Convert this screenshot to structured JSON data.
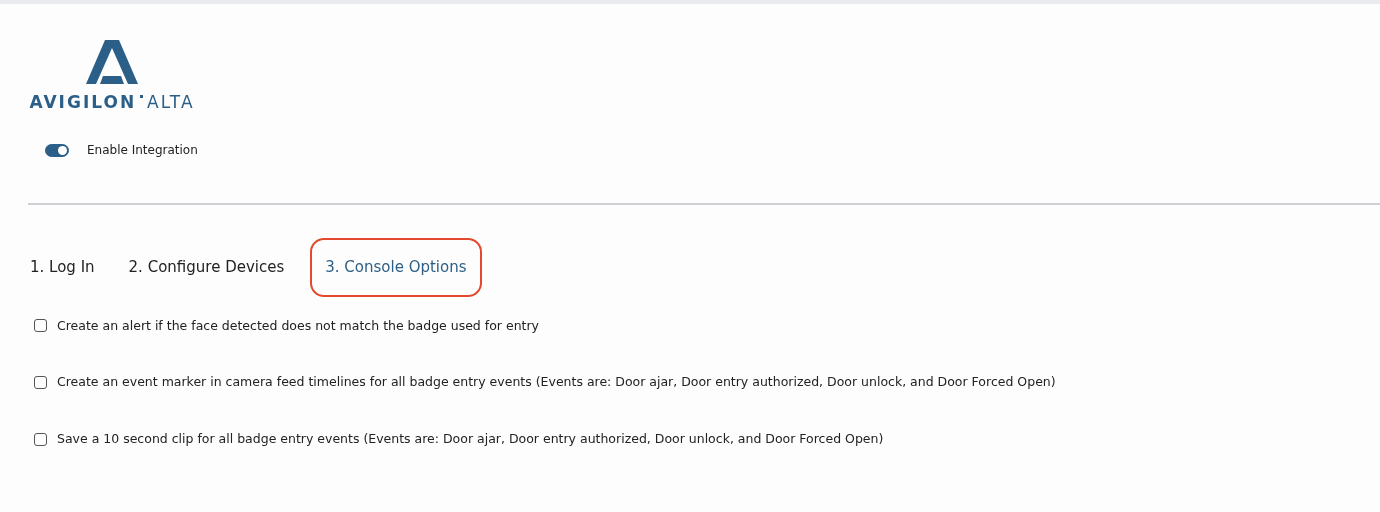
{
  "logo": {
    "brand": "AVIGILON",
    "product": "ALTA"
  },
  "integration": {
    "label": "Enable Integration",
    "on": true
  },
  "tabs": [
    {
      "label": "1. Log In",
      "selected": false
    },
    {
      "label": "2. Configure Devices",
      "selected": false
    },
    {
      "label": "3. Console Options",
      "selected": true
    }
  ],
  "options": [
    {
      "label": "Create an alert if the face detected does not match the badge used for entry",
      "checked": false
    },
    {
      "label": "Create an event marker in camera feed timelines for all badge entry events (Events are: Door ajar, Door entry authorized, Door unlock, and Door Forced Open)",
      "checked": false
    },
    {
      "label": "Save a 10 second clip for all badge entry events (Events are: Door ajar, Door entry authorized, Door unlock, and Door Forced Open)",
      "checked": false
    }
  ]
}
